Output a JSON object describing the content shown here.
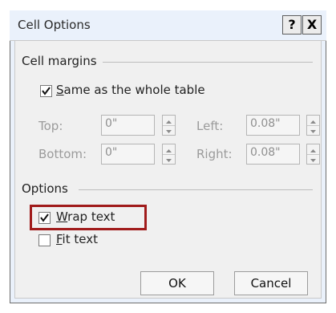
{
  "dialog": {
    "title": "Cell Options",
    "help_label": "?",
    "close_label": "X"
  },
  "cell_margins": {
    "section_label": "Cell margins",
    "same_as_table": {
      "label_first": "S",
      "label_rest": "ame as the whole table",
      "checked": true
    },
    "top": {
      "label": "Top:",
      "value": "0\""
    },
    "bottom": {
      "label": "Bottom:",
      "value": "0\""
    },
    "left": {
      "label": "Left:",
      "value": "0.08\""
    },
    "right": {
      "label": "Right:",
      "value": "0.08\""
    }
  },
  "options": {
    "section_label": "Options",
    "wrap_text": {
      "label_first": "W",
      "label_rest": "rap text",
      "checked": true
    },
    "fit_text": {
      "label_first": "F",
      "label_rest": "it text",
      "checked": false
    }
  },
  "buttons": {
    "ok": "OK",
    "cancel": "Cancel"
  },
  "colors": {
    "highlight": "#a01b1b"
  }
}
